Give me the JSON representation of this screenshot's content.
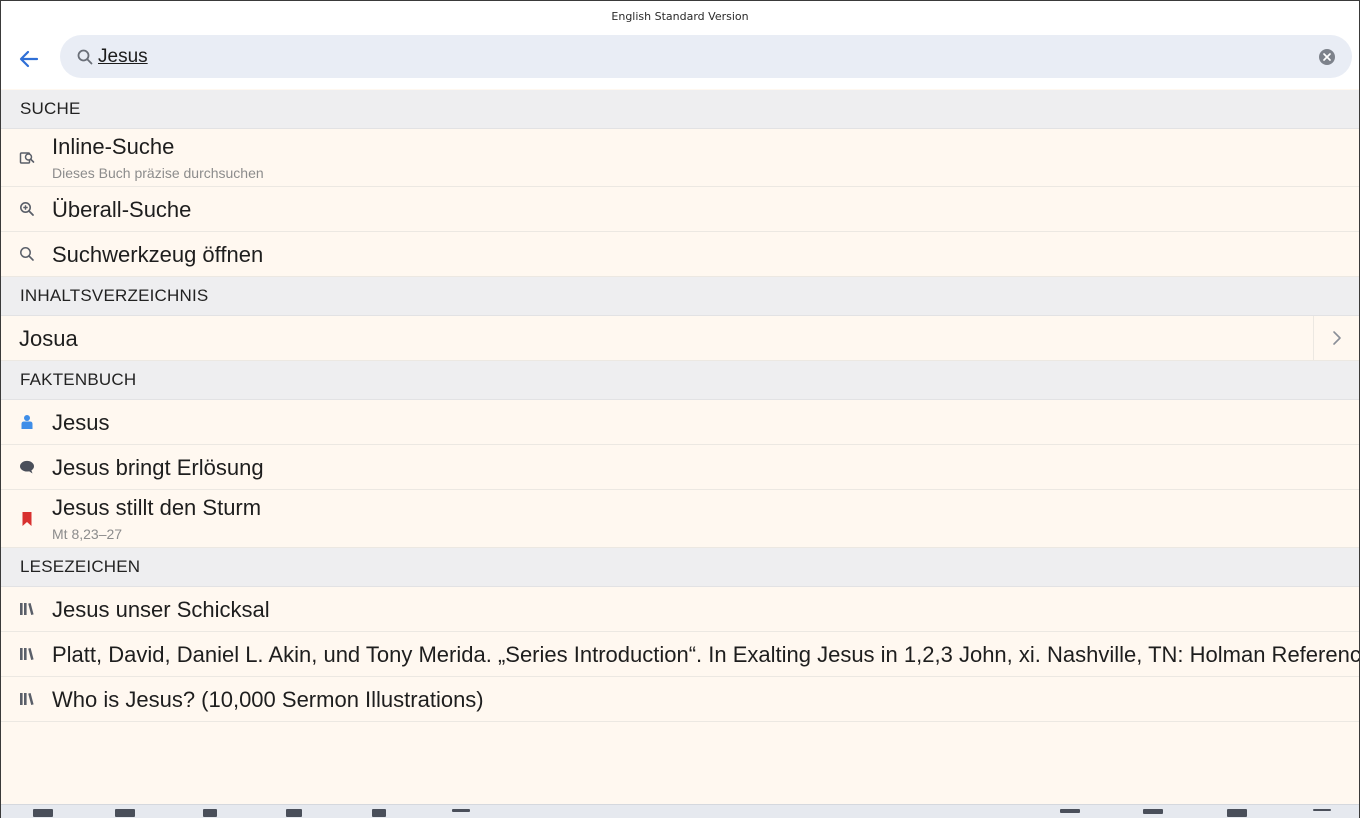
{
  "window": {
    "title": "English Standard Version"
  },
  "search": {
    "value": "Jesus",
    "placeholder": ""
  },
  "sections": [
    {
      "header": "SUCHE",
      "items": [
        {
          "icon": "inline-search-icon",
          "label": "Inline-Suche",
          "sub": "Dieses Buch präzise durchsuchen"
        },
        {
          "icon": "zoom-search-icon",
          "label": "Überall-Suche"
        },
        {
          "icon": "search-icon",
          "label": "Suchwerkzeug öffnen"
        }
      ]
    },
    {
      "header": "INHALTSVERZEICHNIS",
      "items": [
        {
          "label": "Josua"
        }
      ]
    },
    {
      "header": "FAKTENBUCH",
      "items": [
        {
          "icon": "person-icon",
          "label": "Jesus"
        },
        {
          "icon": "speech-bubble-icon",
          "label": "Jesus bringt Erlösung"
        },
        {
          "icon": "bookmark-icon",
          "label": "Jesus stillt den Sturm",
          "sub": "Mt 8,23–27"
        }
      ]
    },
    {
      "header": "LESEZEICHEN",
      "items": [
        {
          "icon": "library-icon",
          "label": "Jesus unser Schicksal"
        },
        {
          "icon": "library-icon",
          "label": "Platt, David, Daniel L. Akin, und Tony Merida. „Series Introduction“. In Exalting Jesus in 1,2,3 John, xi. Nashville, TN: Holman Reference"
        },
        {
          "icon": "library-icon",
          "label": "Who is Jesus? (10,000 Sermon Illustrations)"
        }
      ]
    }
  ],
  "colors": {
    "accent": "#2f6fd6",
    "row_bg": "#fff8f0",
    "header_bg": "#eeeef0",
    "person": "#3f8ee8",
    "bookmark": "#d8312f",
    "icon_gray": "#5a5f69"
  }
}
